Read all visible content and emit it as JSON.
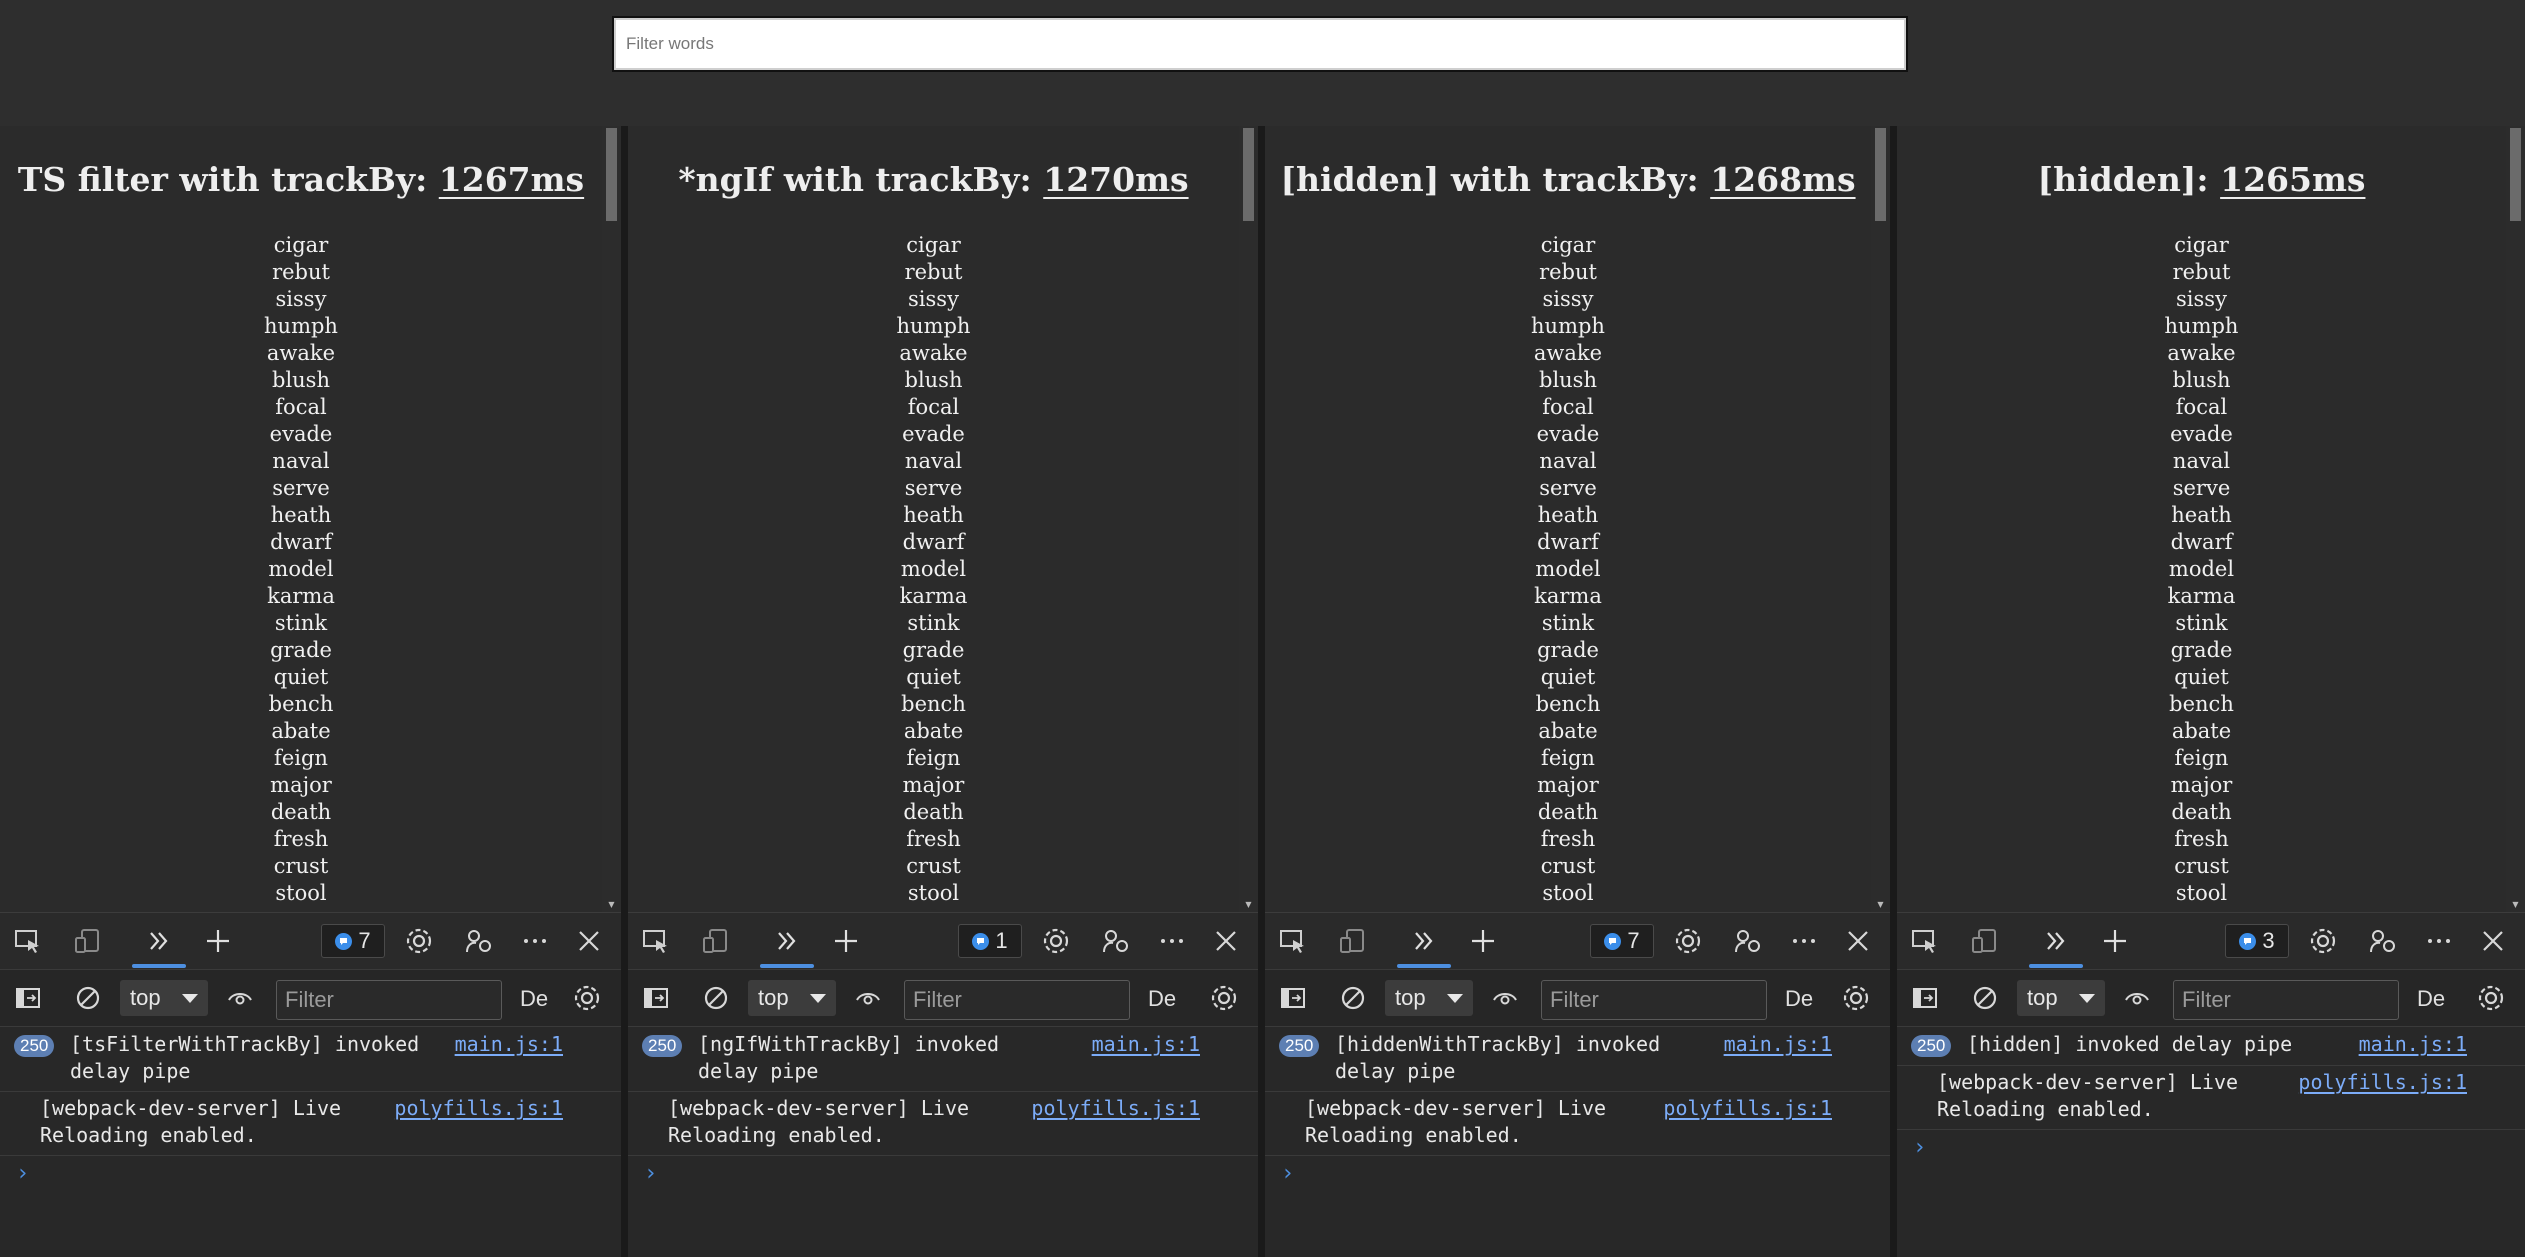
{
  "filter": {
    "placeholder": "Filter words"
  },
  "words": [
    "cigar",
    "rebut",
    "sissy",
    "humph",
    "awake",
    "blush",
    "focal",
    "evade",
    "naval",
    "serve",
    "heath",
    "dwarf",
    "model",
    "karma",
    "stink",
    "grade",
    "quiet",
    "bench",
    "abate",
    "feign",
    "major",
    "death",
    "fresh",
    "crust",
    "stool"
  ],
  "panes": [
    {
      "title": "TS filter with trackBy: ",
      "time": "1267ms",
      "issues": "7",
      "messages": [
        {
          "count": "250",
          "line1": "[tsFilterWithTrackBy] invoked",
          "line2": "delay pipe",
          "source": "main.js:1"
        },
        {
          "count": "",
          "line1": "[webpack-dev-server] Live",
          "line2": "Reloading enabled.",
          "source": "polyfills.js:1"
        }
      ]
    },
    {
      "title": "*ngIf with trackBy: ",
      "time": "1270ms",
      "issues": "1",
      "messages": [
        {
          "count": "250",
          "line1": "[ngIfWithTrackBy] invoked",
          "line2": "delay pipe",
          "source": "main.js:1"
        },
        {
          "count": "",
          "line1": "[webpack-dev-server] Live",
          "line2": "Reloading enabled.",
          "source": "polyfills.js:1"
        }
      ]
    },
    {
      "title": "[hidden] with trackBy: ",
      "time": "1268ms",
      "issues": "7",
      "messages": [
        {
          "count": "250",
          "line1": "[hiddenWithTrackBy] invoked",
          "line2": "delay pipe",
          "source": "main.js:1"
        },
        {
          "count": "",
          "line1": "[webpack-dev-server] Live",
          "line2": "Reloading enabled.",
          "source": "polyfills.js:1"
        }
      ]
    },
    {
      "title": "[hidden]: ",
      "time": "1265ms",
      "issues": "3",
      "messages": [
        {
          "count": "250",
          "line1": "[hidden] invoked delay pipe",
          "line2": "",
          "source": "main.js:1"
        },
        {
          "count": "",
          "line1": "[webpack-dev-server] Live",
          "line2": "Reloading enabled.",
          "source": "polyfills.js:1"
        }
      ]
    }
  ],
  "devtools": {
    "context": "top",
    "filter_placeholder": "Filter",
    "levels": "De",
    "prompt": "›"
  },
  "colors": {
    "accent": "#4d8fe0",
    "link": "#7cacf8",
    "badge": "#5d7fb3"
  }
}
